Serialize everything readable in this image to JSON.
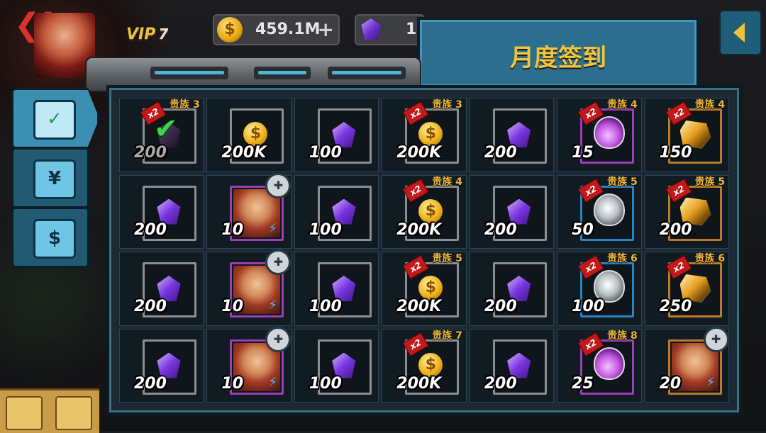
{
  "top_bar": {
    "vip_label": "VIP",
    "vip_level": "7",
    "gold_amount": "459.1M",
    "gem_amount": "1"
  },
  "title": "月度签到",
  "side_tabs": [
    {
      "name": "daily-checkin",
      "icon": "calendar-check-icon"
    },
    {
      "name": "shop",
      "icon": "shopping-bag-icon"
    },
    {
      "name": "cash",
      "icon": "money-icon"
    }
  ],
  "rewards": [
    {
      "noble": "贵族 3",
      "x2": true,
      "item": "gem",
      "frame": "gray",
      "qty": "200",
      "claimed": true
    },
    {
      "noble": "",
      "x2": false,
      "item": "coin",
      "frame": "gray",
      "qty": "200K"
    },
    {
      "noble": "",
      "x2": false,
      "item": "gem",
      "frame": "gray",
      "qty": "100"
    },
    {
      "noble": "贵族 3",
      "x2": true,
      "item": "coin",
      "frame": "gray",
      "qty": "200K"
    },
    {
      "noble": "",
      "x2": false,
      "item": "gem",
      "frame": "gray",
      "qty": "200"
    },
    {
      "noble": "贵族 4",
      "x2": true,
      "item": "potion",
      "frame": "purple",
      "qty": "15"
    },
    {
      "noble": "贵族 4",
      "x2": true,
      "item": "crystal",
      "frame": "orange",
      "qty": "150"
    },
    {
      "noble": "",
      "x2": false,
      "item": "gem",
      "frame": "gray",
      "qty": "200"
    },
    {
      "noble": "",
      "x2": false,
      "item": "hero",
      "frame": "purple",
      "qty": "10"
    },
    {
      "noble": "",
      "x2": false,
      "item": "gem",
      "frame": "gray",
      "qty": "100"
    },
    {
      "noble": "贵族 4",
      "x2": true,
      "item": "coin",
      "frame": "gray",
      "qty": "200K"
    },
    {
      "noble": "",
      "x2": false,
      "item": "gem",
      "frame": "gray",
      "qty": "200"
    },
    {
      "noble": "贵族 5",
      "x2": true,
      "item": "potion-blue",
      "frame": "blue",
      "qty": "50"
    },
    {
      "noble": "贵族 5",
      "x2": true,
      "item": "crystal",
      "frame": "orange",
      "qty": "200"
    },
    {
      "noble": "",
      "x2": false,
      "item": "gem",
      "frame": "gray",
      "qty": "200"
    },
    {
      "noble": "",
      "x2": false,
      "item": "hero",
      "frame": "purple",
      "qty": "10"
    },
    {
      "noble": "",
      "x2": false,
      "item": "gem",
      "frame": "gray",
      "qty": "100"
    },
    {
      "noble": "贵族 5",
      "x2": true,
      "item": "coin",
      "frame": "gray",
      "qty": "200K"
    },
    {
      "noble": "",
      "x2": false,
      "item": "gem",
      "frame": "gray",
      "qty": "200"
    },
    {
      "noble": "贵族 6",
      "x2": true,
      "item": "potion-blue",
      "frame": "blue",
      "qty": "100"
    },
    {
      "noble": "贵族 6",
      "x2": true,
      "item": "crystal",
      "frame": "orange",
      "qty": "250"
    },
    {
      "noble": "",
      "x2": false,
      "item": "gem",
      "frame": "gray",
      "qty": "200"
    },
    {
      "noble": "",
      "x2": false,
      "item": "hero",
      "frame": "purple",
      "qty": "10"
    },
    {
      "noble": "",
      "x2": false,
      "item": "gem",
      "frame": "gray",
      "qty": "100"
    },
    {
      "noble": "贵族 7",
      "x2": true,
      "item": "coin",
      "frame": "gray",
      "qty": "200K"
    },
    {
      "noble": "",
      "x2": false,
      "item": "gem",
      "frame": "gray",
      "qty": "200"
    },
    {
      "noble": "贵族 8",
      "x2": true,
      "item": "potion",
      "frame": "purple",
      "qty": "25"
    },
    {
      "noble": "",
      "x2": false,
      "item": "hero",
      "frame": "orange",
      "qty": "20"
    }
  ],
  "labels": {
    "x2": "x2",
    "coin_symbol": "$"
  }
}
